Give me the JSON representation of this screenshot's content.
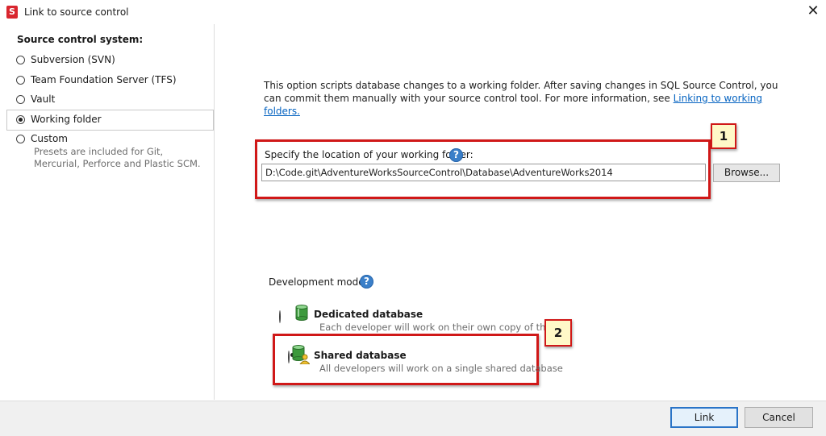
{
  "window": {
    "title": "Link to source control",
    "app_icon_letter": "S"
  },
  "sidebar": {
    "heading": "Source control system:",
    "options": [
      {
        "label": "Subversion (SVN)",
        "checked": false
      },
      {
        "label": "Team Foundation Server (TFS)",
        "checked": false
      },
      {
        "label": "Vault",
        "checked": false
      },
      {
        "label": "Working folder",
        "checked": true
      },
      {
        "label": "Custom",
        "checked": false
      }
    ],
    "custom_description": "Presets are included for Git, Mercurial, Perforce and Plastic SCM."
  },
  "main": {
    "intro_text": "This option scripts database changes to a working folder. After saving changes in SQL Source Control, you can commit them manually with your source control tool. For more information, see ",
    "intro_link": "Linking to working folders.",
    "location_label": "Specify the location of your working folder:",
    "location_value": "D:\\Code.git\\AdventureWorksSourceControl\\Database\\AdventureWorks2014",
    "browse_label": "Browse...",
    "dev_model_label": "Development model:",
    "dedicated": {
      "title": "Dedicated database",
      "description": "Each developer will work on their own copy of the data",
      "checked": false
    },
    "shared": {
      "title": "Shared database",
      "description": "All developers will work on a single shared database",
      "checked": true
    },
    "help_glyph": "?"
  },
  "annotations": {
    "callout_1": "1",
    "callout_2": "2"
  },
  "footer": {
    "link_label": "Link",
    "cancel_label": "Cancel"
  },
  "colors": {
    "callout_border": "#d01818",
    "callout_tag_bg": "#fff9c8",
    "link": "#0563c1",
    "help_icon": "#3a7fc9"
  }
}
